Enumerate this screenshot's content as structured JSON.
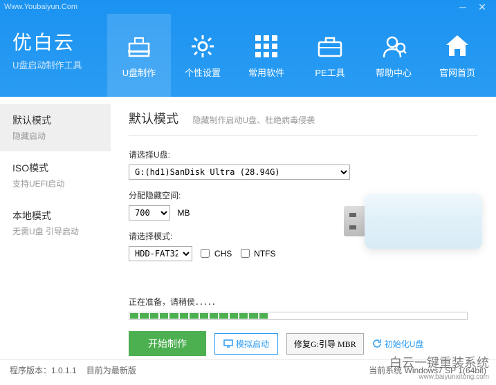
{
  "titlebar": {
    "url": "Www.Youbaiyun.Com"
  },
  "logo": {
    "title": "优白云",
    "subtitle": "U盘启动制作工具"
  },
  "nav": [
    {
      "label": "U盘制作"
    },
    {
      "label": "个性设置"
    },
    {
      "label": "常用软件"
    },
    {
      "label": "PE工具"
    },
    {
      "label": "帮助中心"
    },
    {
      "label": "官网首页"
    }
  ],
  "sidebar": [
    {
      "title": "默认模式",
      "sub": "隐藏启动"
    },
    {
      "title": "ISO模式",
      "sub": "支持UEFI启动"
    },
    {
      "title": "本地模式",
      "sub": "无需U盘 引导启动"
    }
  ],
  "page": {
    "title": "默认模式",
    "subtitle": "隐藏制作启动U盘、杜绝病毒侵袭"
  },
  "fields": {
    "disk_label": "请选择U盘:",
    "disk_value": "G:(hd1)SanDisk Ultra (28.94G)",
    "space_label": "分配隐藏空间:",
    "space_value": "700",
    "space_unit": "MB",
    "mode_label": "请选择模式:",
    "mode_value": "HDD-FAT32",
    "chs": "CHS",
    "ntfs": "NTFS"
  },
  "progress": {
    "label": "正在准备，请稍侯．．．．．",
    "filled": 14,
    "total": 34
  },
  "actions": {
    "start": "开始制作",
    "simulate": "模拟启动",
    "repair": "修复G:引导 MBR",
    "init": "初始化U盘"
  },
  "status": {
    "version_label": "程序版本：",
    "version": "1.0.1.1",
    "version_note": "目前为最新版",
    "os": "当前系统 Windows7 SP 1(64bit)"
  },
  "watermark": {
    "main": "白云一键重装系统",
    "sub": "www.baiyunxitong.com"
  }
}
